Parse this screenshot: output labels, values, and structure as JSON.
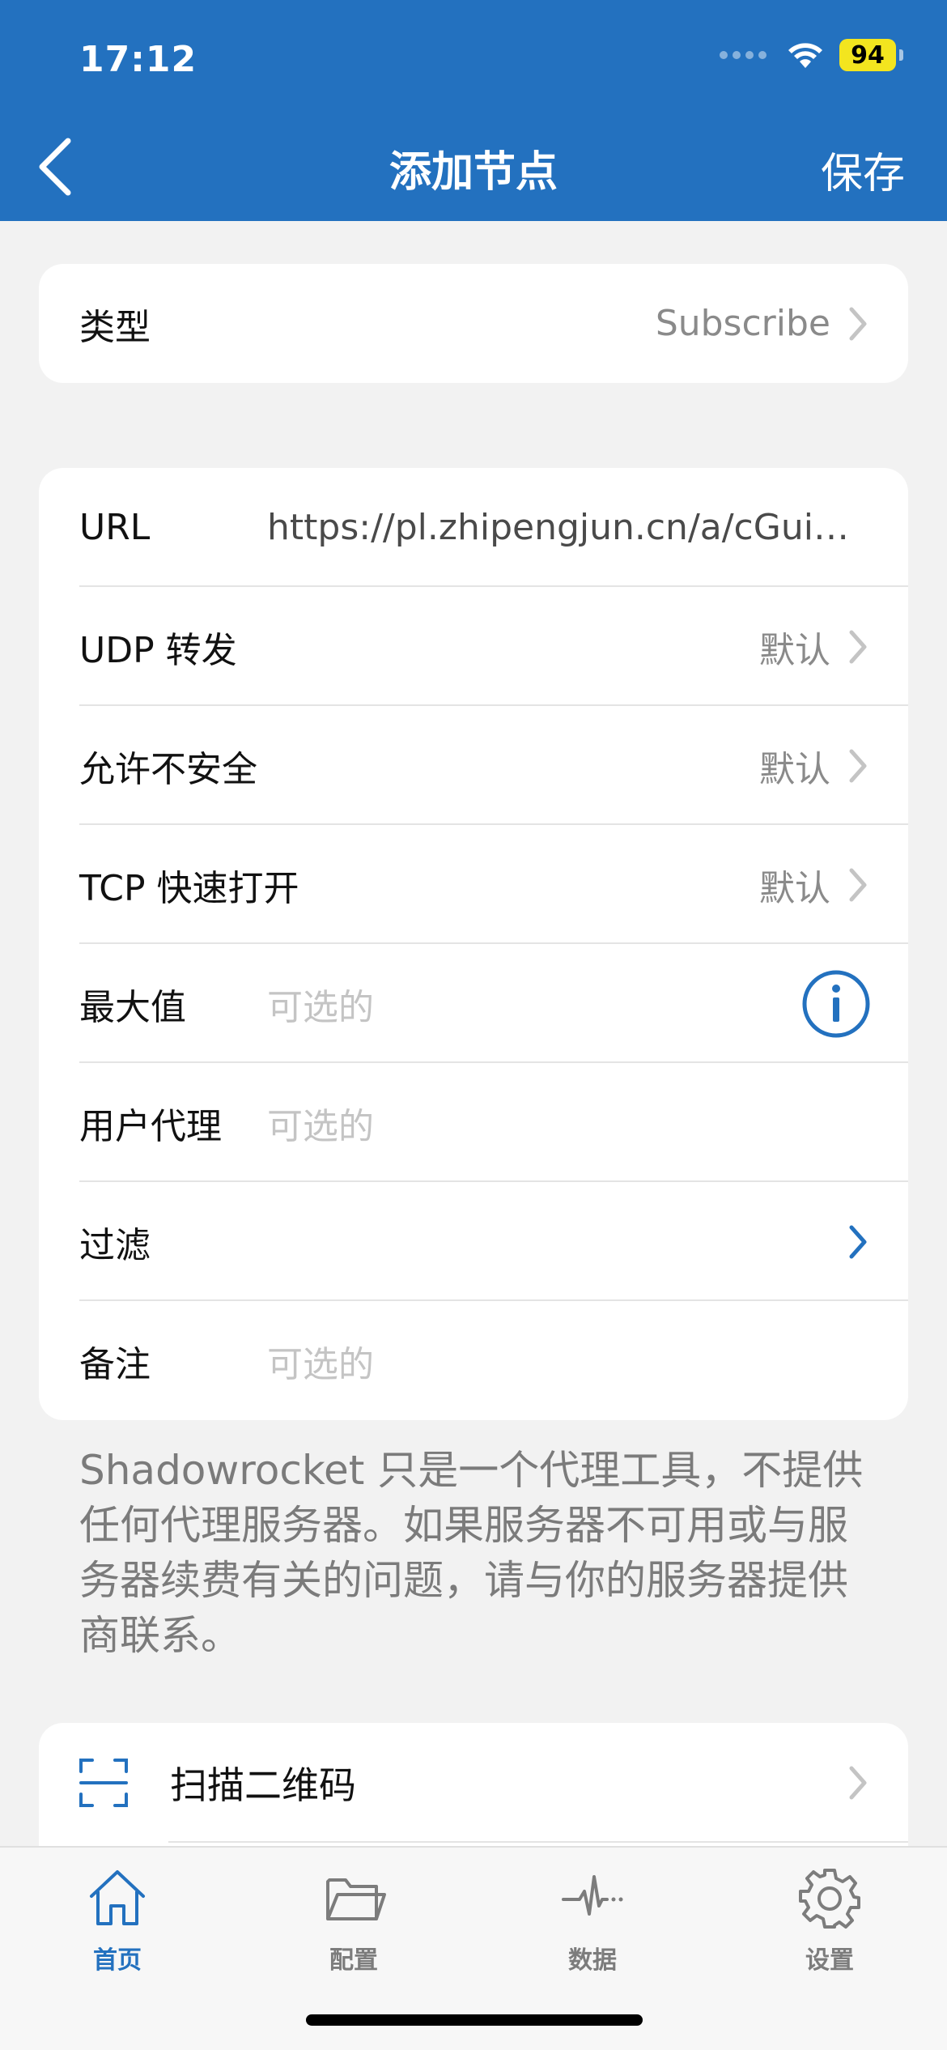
{
  "status_bar": {
    "time": "17:12",
    "battery": "94"
  },
  "nav": {
    "title": "添加节点",
    "save_label": "保存"
  },
  "type_row": {
    "label": "类型",
    "value": "Subscribe"
  },
  "form": {
    "url": {
      "label": "URL",
      "value": "https://pl.zhipengjun.cn/a/cGuip..."
    },
    "udp": {
      "label": "UDP 转发",
      "value": "默认"
    },
    "insecure": {
      "label": "允许不安全",
      "value": "默认"
    },
    "tfo": {
      "label": "TCP 快速打开",
      "value": "默认"
    },
    "max": {
      "label": "最大值",
      "placeholder": "可选的"
    },
    "user_agent": {
      "label": "用户代理",
      "placeholder": "可选的"
    },
    "filter": {
      "label": "过滤"
    },
    "remark": {
      "label": "备注",
      "placeholder": "可选的"
    }
  },
  "footnote": "Shadowrocket 只是一个代理工具，不提供任何代理服务器。如果服务器不可用或与服务器续费有关的问题，请与你的服务器提供商联系。",
  "actions": {
    "scan_qr": "扫描二维码"
  },
  "tabs": [
    {
      "label": "首页",
      "icon": "home-icon"
    },
    {
      "label": "配置",
      "icon": "folder-icon"
    },
    {
      "label": "数据",
      "icon": "pulse-icon"
    },
    {
      "label": "设置",
      "icon": "gear-icon"
    }
  ],
  "colors": {
    "accent": "#2371bf",
    "battery": "#f3e51f",
    "background": "#f2f2f2"
  }
}
